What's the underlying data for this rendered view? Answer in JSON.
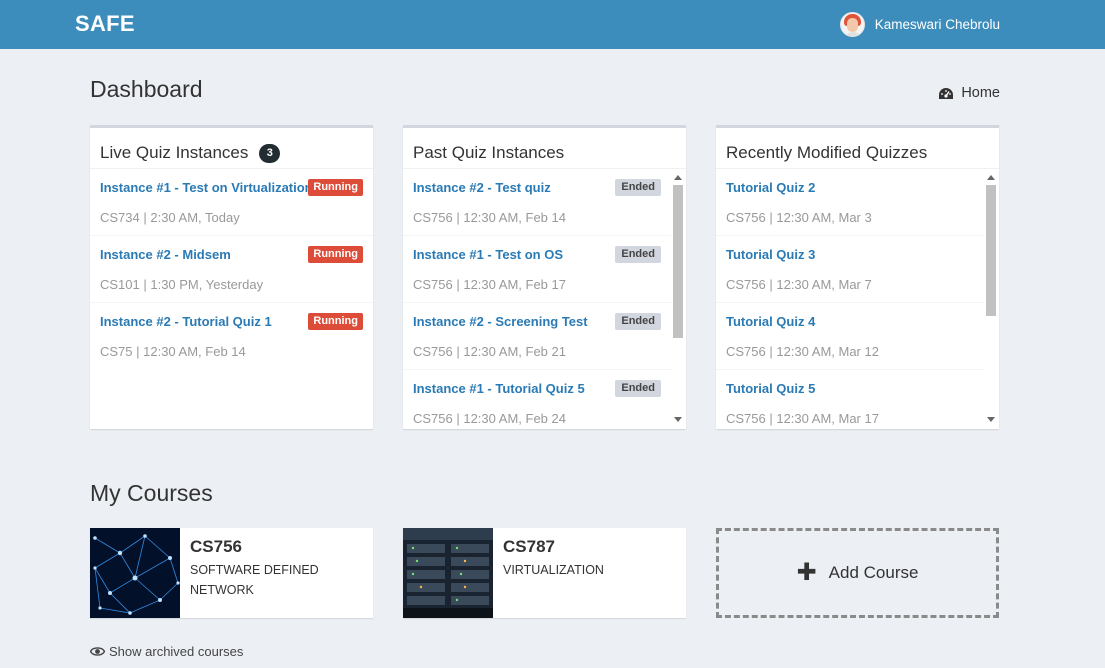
{
  "header": {
    "brand": "SAFE",
    "user_name": "Kameswari Chebrolu"
  },
  "page": {
    "title": "Dashboard",
    "home_label": "Home"
  },
  "live_quiz": {
    "title": "Live Quiz Instances",
    "count": "3",
    "items": [
      {
        "title": "Instance #1 - Test on Virtualization",
        "meta": "CS734 | 2:30 AM, Today",
        "status": "Running"
      },
      {
        "title": "Instance #2 - Midsem",
        "meta": "CS101 | 1:30 PM, Yesterday",
        "status": "Running"
      },
      {
        "title": "Instance #2 - Tutorial Quiz 1",
        "meta": "CS75 | 12:30 AM, Feb 14",
        "status": "Running"
      }
    ]
  },
  "past_quiz": {
    "title": "Past Quiz Instances",
    "items": [
      {
        "title": "Instance #2 - Test quiz",
        "meta": "CS756 | 12:30 AM, Feb 14",
        "status": "Ended"
      },
      {
        "title": "Instance #1 - Test on OS",
        "meta": "CS756 | 12:30 AM, Feb 17",
        "status": "Ended"
      },
      {
        "title": "Instance #2 - Screening Test",
        "meta": "CS756 | 12:30 AM, Feb 21",
        "status": "Ended"
      },
      {
        "title": "Instance #1 - Tutorial Quiz 5",
        "meta": "CS756 | 12:30 AM, Feb 24",
        "status": "Ended"
      }
    ]
  },
  "recent_quizzes": {
    "title": "Recently Modified Quizzes",
    "items": [
      {
        "title": "Tutorial Quiz 2",
        "meta": "CS756 | 12:30 AM, Mar 3"
      },
      {
        "title": "Tutorial Quiz 3",
        "meta": "CS756 | 12:30 AM, Mar 7"
      },
      {
        "title": "Tutorial Quiz 4",
        "meta": "CS756 | 12:30 AM, Mar 12"
      },
      {
        "title": "Tutorial Quiz 5",
        "meta": "CS756 | 12:30 AM, Mar 17"
      }
    ]
  },
  "courses": {
    "title": "My Courses",
    "items": [
      {
        "code": "CS756",
        "name": "SOFTWARE DEFINED NETWORK"
      },
      {
        "code": "CS787",
        "name": "VIRTUALIZATION"
      }
    ],
    "add_label": "Add Course",
    "archived_label": "Show archived courses"
  },
  "colors": {
    "topbar": "#3c8dbc",
    "link": "#2a7ab5",
    "running": "#dd4b39",
    "ended": "#d2d6de",
    "background": "#ecf0f5"
  }
}
